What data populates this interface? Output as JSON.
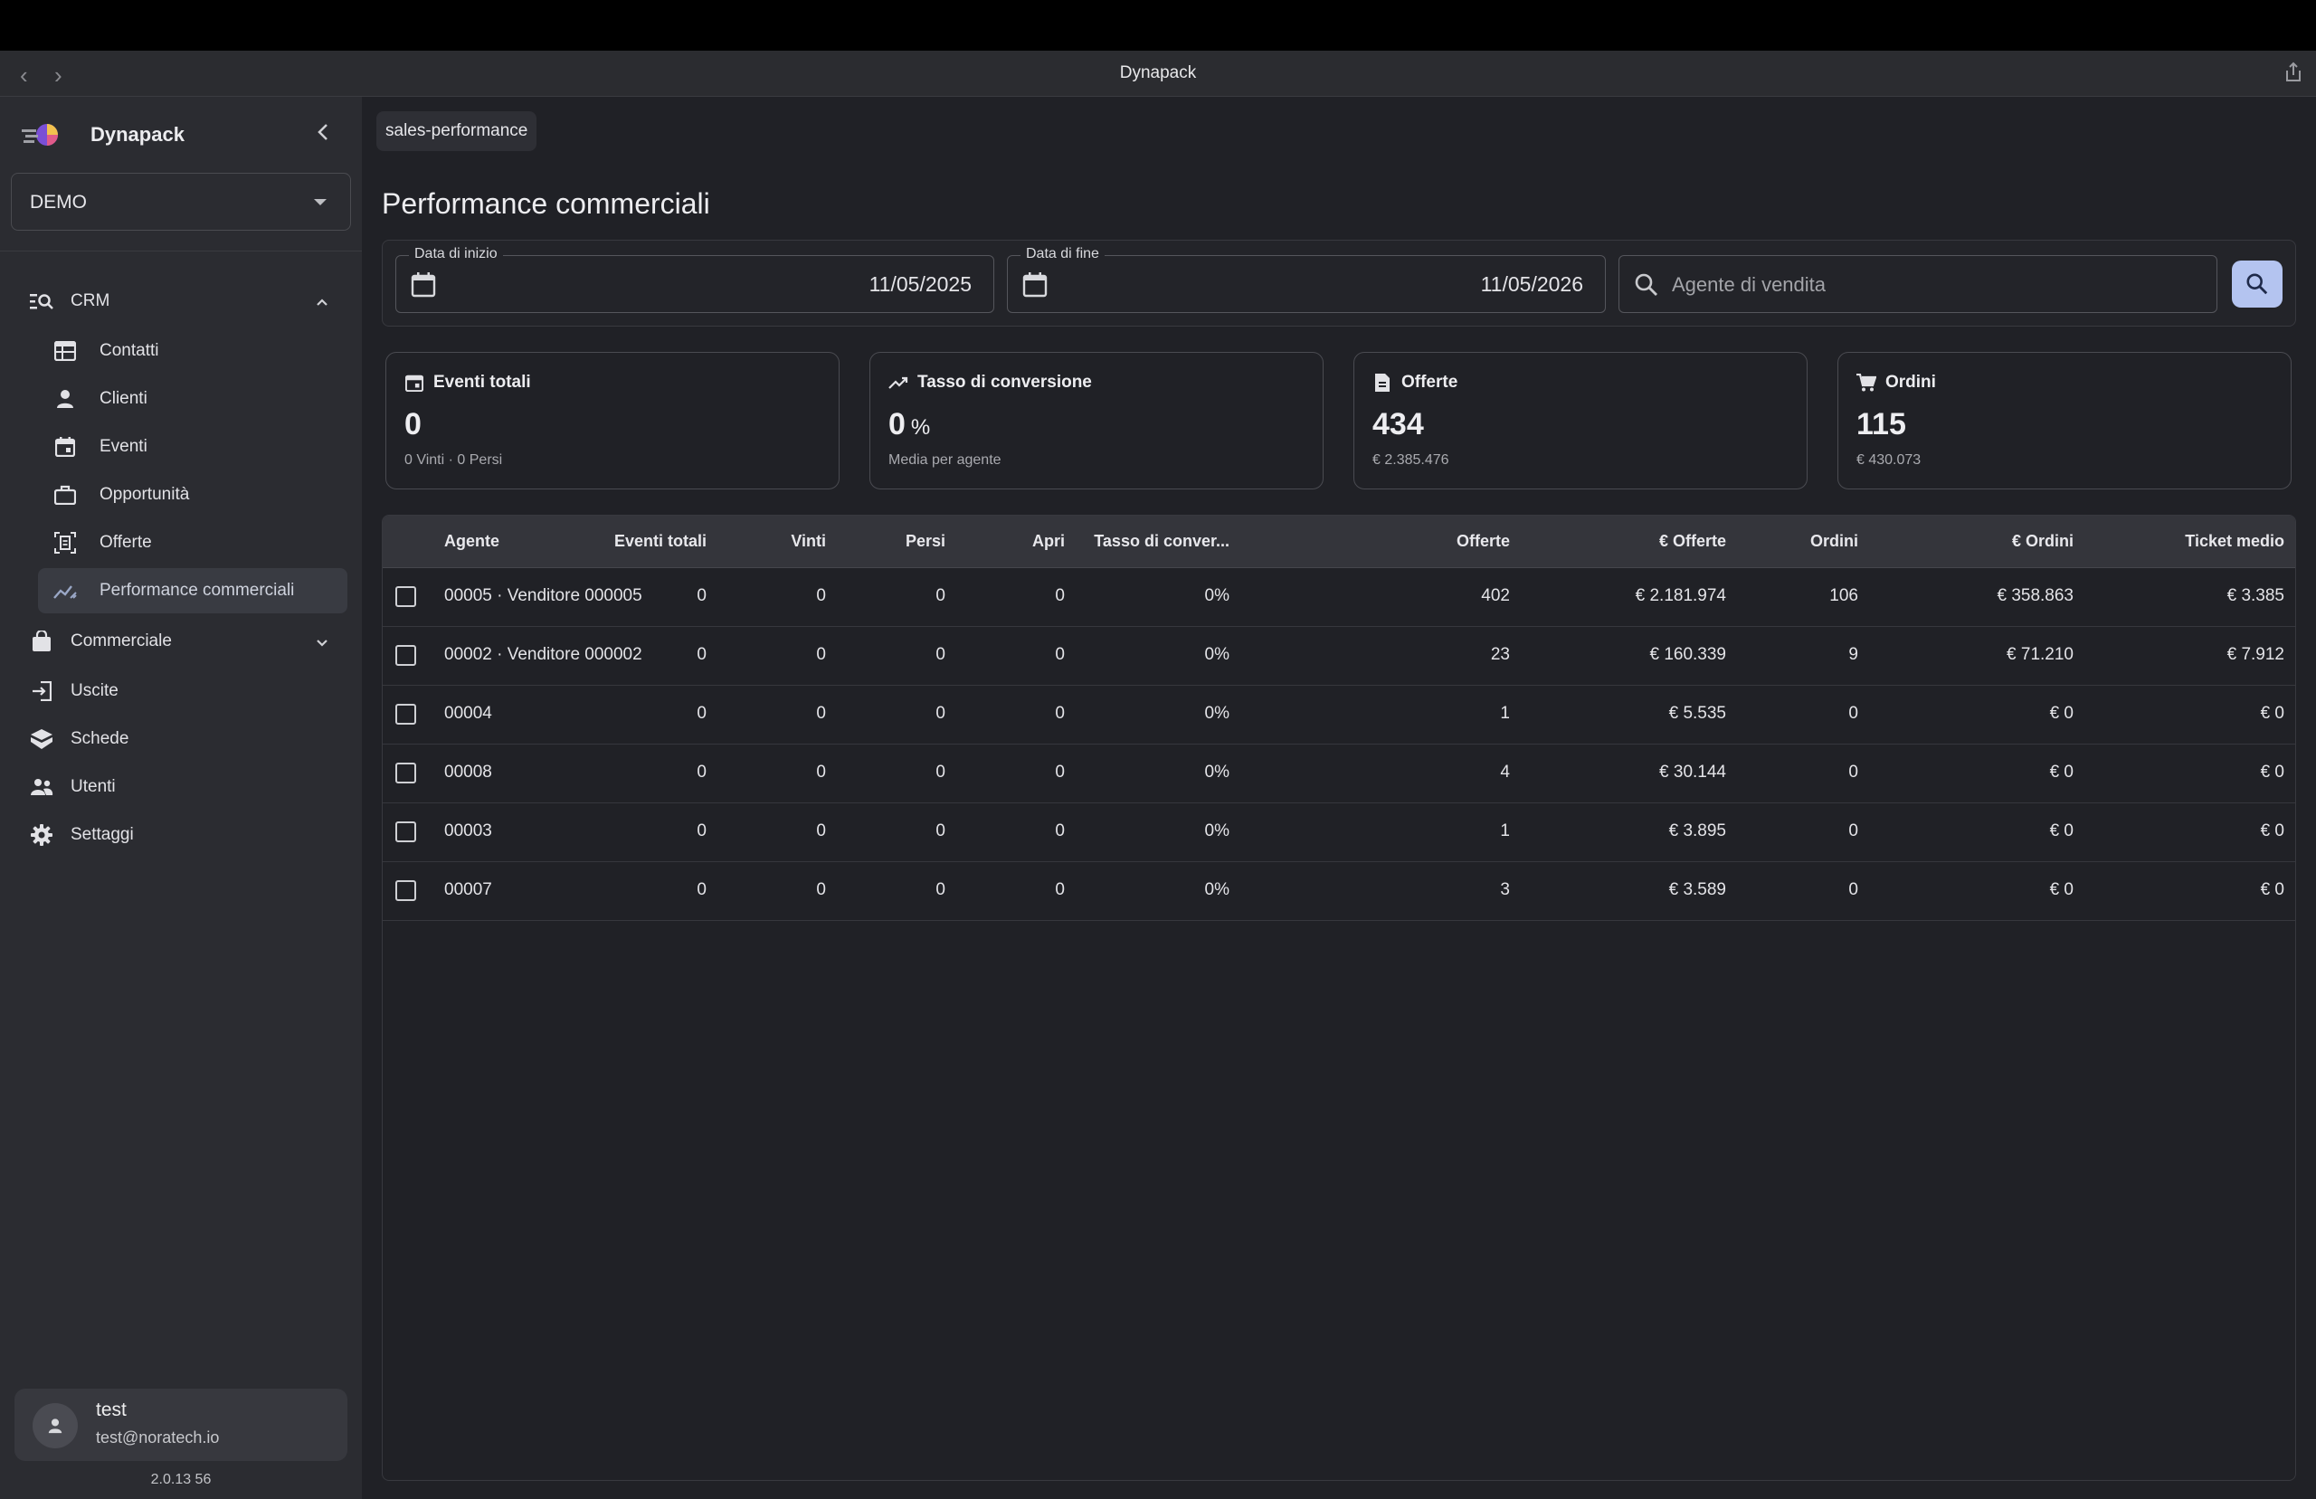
{
  "window": {
    "title": "Dynapack"
  },
  "sidebar": {
    "brand": "Dynapack",
    "org_select": "DEMO",
    "items": [
      {
        "label": "CRM",
        "icon": "crm-search-icon",
        "expanded": true
      },
      {
        "label": "Contatti",
        "icon": "contacts-table-icon"
      },
      {
        "label": "Clienti",
        "icon": "person-icon"
      },
      {
        "label": "Eventi",
        "icon": "calendar-icon"
      },
      {
        "label": "Opportunità",
        "icon": "briefcase-icon"
      },
      {
        "label": "Offerte",
        "icon": "document-scan-icon"
      },
      {
        "label": "Performance commerciali",
        "icon": "trend-icon",
        "active": true
      },
      {
        "label": "Commerciale",
        "icon": "shopping-bag-icon",
        "expanded": false
      },
      {
        "label": "Uscite",
        "icon": "exit-icon"
      },
      {
        "label": "Schede",
        "icon": "cube-icon"
      },
      {
        "label": "Utenti",
        "icon": "people-icon"
      },
      {
        "label": "Settaggi",
        "icon": "gear-icon"
      }
    ],
    "user": {
      "name": "test",
      "email": "test@noratech.io"
    },
    "version": "2.0.13 56"
  },
  "main": {
    "breadcrumb": "sales-performance",
    "title": "Performance commerciali",
    "filters": {
      "start_label": "Data di inizio",
      "start_value": "11/05/2025",
      "end_label": "Data di fine",
      "end_value": "11/05/2026",
      "agent_placeholder": "Agente di vendita"
    },
    "cards": [
      {
        "title": "Eventi totali",
        "value": "0",
        "unit": "",
        "sub": "0 Vinti · 0 Persi",
        "icon": "calendar-icon"
      },
      {
        "title": "Tasso di conversione",
        "value": "0",
        "unit": "%",
        "sub": "Media per agente",
        "icon": "trend-up-icon"
      },
      {
        "title": "Offerte",
        "value": "434",
        "unit": "",
        "sub": "€ 2.385.476",
        "icon": "document-icon"
      },
      {
        "title": "Ordini",
        "value": "115",
        "unit": "",
        "sub": "€ 430.073",
        "icon": "cart-icon"
      }
    ],
    "table": {
      "columns": [
        "Agente",
        "Eventi totali",
        "Vinti",
        "Persi",
        "Apri",
        "Tasso di conver...",
        "Offerte",
        "€ Offerte",
        "Ordini",
        "€ Ordini",
        "Ticket medio"
      ],
      "rows": [
        [
          "00005 · Venditore 000005",
          "0",
          "0",
          "0",
          "0",
          "0%",
          "402",
          "€ 2.181.974",
          "106",
          "€ 358.863",
          "€ 3.385"
        ],
        [
          "00002 · Venditore 000002",
          "0",
          "0",
          "0",
          "0",
          "0%",
          "23",
          "€ 160.339",
          "9",
          "€ 71.210",
          "€ 7.912"
        ],
        [
          "00004",
          "0",
          "0",
          "0",
          "0",
          "0%",
          "1",
          "€ 5.535",
          "0",
          "€ 0",
          "€ 0"
        ],
        [
          "00008",
          "0",
          "0",
          "0",
          "0",
          "0%",
          "4",
          "€ 30.144",
          "0",
          "€ 0",
          "€ 0"
        ],
        [
          "00003",
          "0",
          "0",
          "0",
          "0",
          "0%",
          "1",
          "€ 3.895",
          "0",
          "€ 0",
          "€ 0"
        ],
        [
          "00007",
          "0",
          "0",
          "0",
          "0",
          "0%",
          "3",
          "€ 3.589",
          "0",
          "€ 0",
          "€ 0"
        ]
      ]
    }
  },
  "colors": {
    "accent": "#b4c4f0",
    "sidebar_bg": "#2b2c31",
    "main_bg": "#202126"
  }
}
